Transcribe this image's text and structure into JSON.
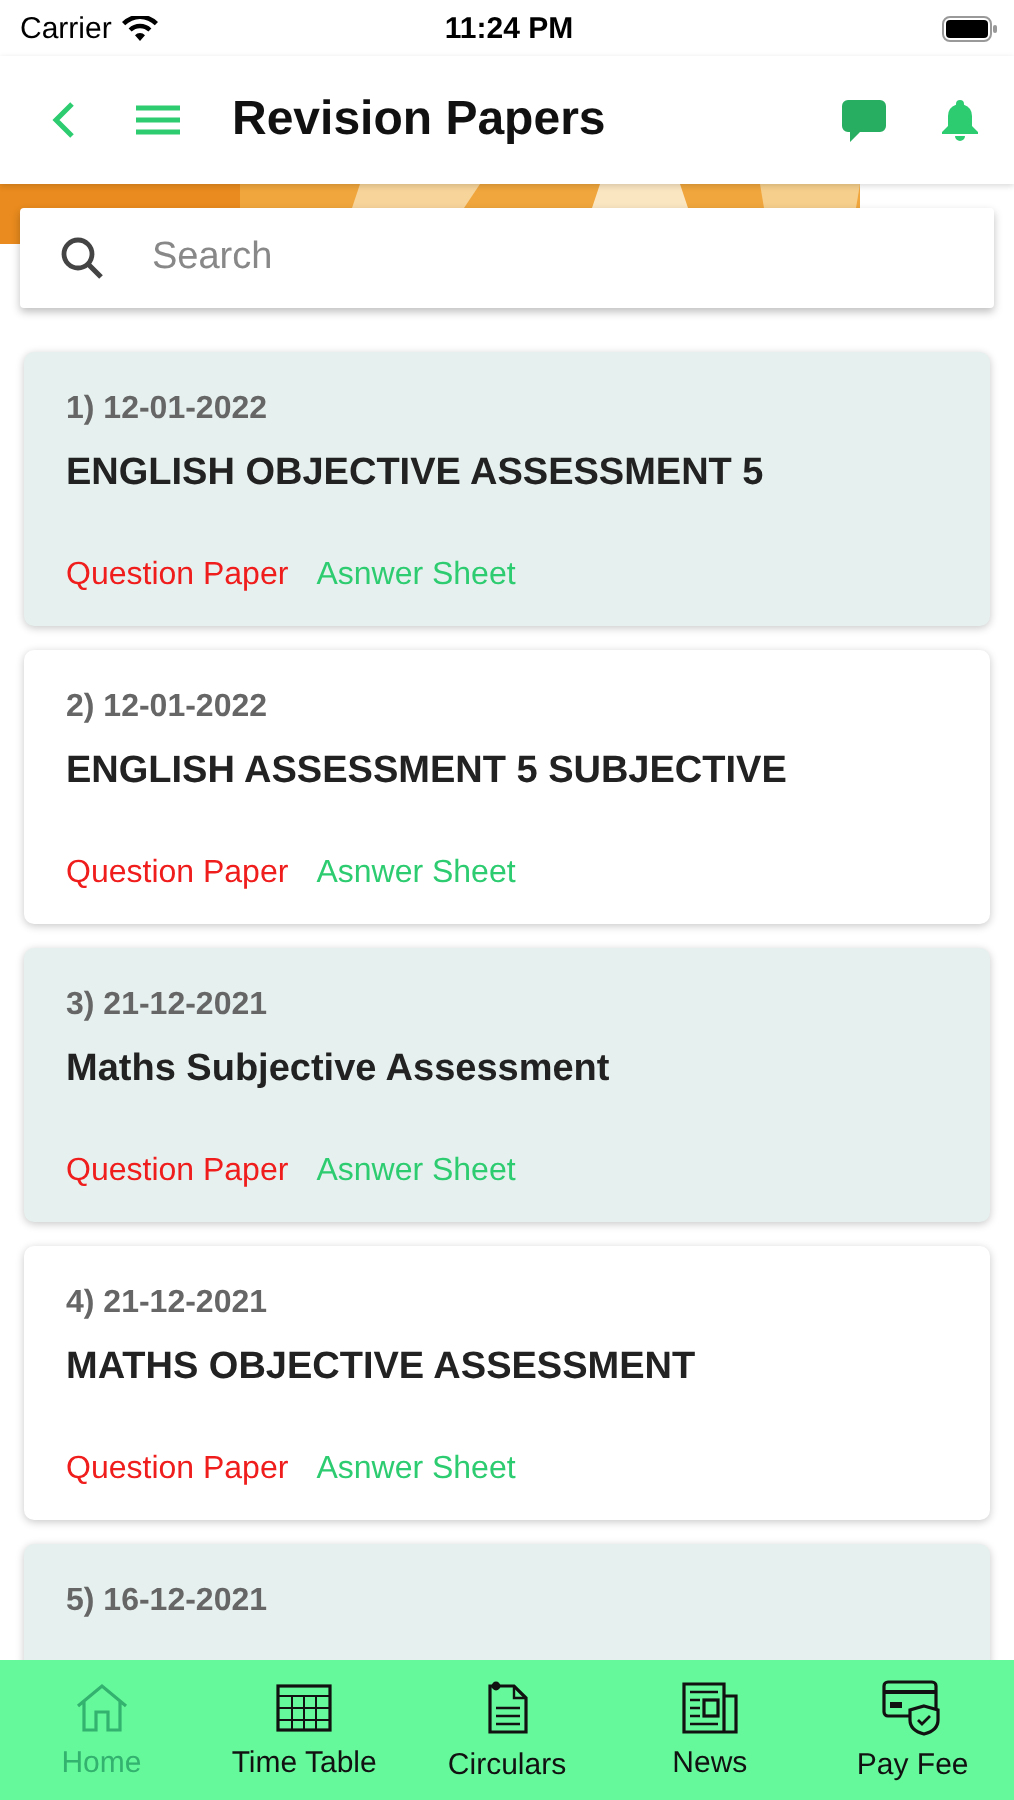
{
  "status_bar": {
    "carrier": "Carrier",
    "time": "11:24 PM"
  },
  "header": {
    "title": "Revision Papers"
  },
  "search": {
    "placeholder": "Search"
  },
  "papers": [
    {
      "date": "1) 12-01-2022",
      "title": "ENGLISH OBJECTIVE ASSESSMENT 5",
      "question_link": "Question Paper",
      "answer_link": "Asnwer Sheet",
      "shaded": true
    },
    {
      "date": "2) 12-01-2022",
      "title": "ENGLISH ASSESSMENT 5 SUBJECTIVE",
      "question_link": "Question Paper",
      "answer_link": "Asnwer Sheet",
      "shaded": false
    },
    {
      "date": "3) 21-12-2021",
      "title": "Maths Subjective Assessment",
      "question_link": "Question Paper",
      "answer_link": "Asnwer Sheet",
      "shaded": true
    },
    {
      "date": "4) 21-12-2021",
      "title": "MATHS OBJECTIVE ASSESSMENT",
      "question_link": "Question Paper",
      "answer_link": "Asnwer Sheet",
      "shaded": false
    },
    {
      "date": "5) 16-12-2021",
      "shaded": true
    }
  ],
  "tab_bar": [
    {
      "label": "Home",
      "kind": "home",
      "selected": true
    },
    {
      "label": "Time Table",
      "kind": "timetable",
      "selected": false
    },
    {
      "label": "Circulars",
      "kind": "circulars",
      "selected": false
    },
    {
      "label": "News",
      "kind": "news",
      "selected": false
    },
    {
      "label": "Pay Fee",
      "kind": "payfee",
      "selected": false
    }
  ]
}
